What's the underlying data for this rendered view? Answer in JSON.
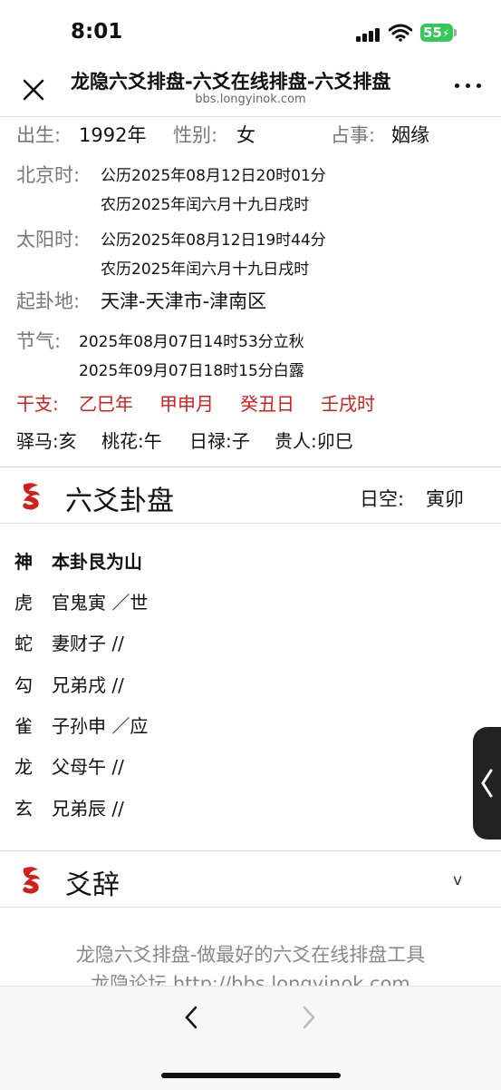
{
  "status": {
    "time": "8:01",
    "battery": "55"
  },
  "nav": {
    "title": "龙隐六爻排盘-六爻在线排盘-六爻排盘",
    "url": "bbs.longyinok.com"
  },
  "info": {
    "birth_label": "出生:",
    "birth_value": "1992年",
    "gender_label": "性别:",
    "gender_value": "女",
    "matter_label": "占事:",
    "matter_value": "姻缘",
    "beijing_label": "北京时:",
    "beijing_line1": "公历2025年08月12日20时01分",
    "beijing_line2": "农历2025年闰六月十九日戌时",
    "solar_label": "太阳时:",
    "solar_line1": "公历2025年08月12日19时44分",
    "solar_line2": "农历2025年闰六月十九日戌时",
    "place_label": "起卦地:",
    "place_value": "天津-天津市-津南区",
    "term_label": "节气:",
    "term_line1": "2025年08月07日14时53分立秋",
    "term_line2": "2025年09月07日18时15分白露",
    "ganzhi_label": "干支:",
    "ganzhi": [
      "乙巳年",
      "甲申月",
      "癸丑日",
      "壬戌时"
    ],
    "extras": [
      "驿马:亥",
      "桃花:午",
      "日禄:子",
      "贵人:卯巳"
    ]
  },
  "hexagram": {
    "title": "六爻卦盘",
    "void_label": "日空:",
    "void_value": "寅卯",
    "header_god": "神",
    "header_name": "本卦艮为山",
    "lines": [
      {
        "god": "虎",
        "text": "官鬼寅 ／世"
      },
      {
        "god": "蛇",
        "text": "妻财子 //"
      },
      {
        "god": "勾",
        "text": "兄弟戌 //"
      },
      {
        "god": "雀",
        "text": "子孙申 ／应"
      },
      {
        "god": "龙",
        "text": "父母午 //"
      },
      {
        "god": "玄",
        "text": "兄弟辰 //"
      }
    ]
  },
  "ci": {
    "title": "爻辞",
    "toggle": "v"
  },
  "footer": {
    "line1": "龙隐六爻排盘-做最好的六爻在线排盘工具",
    "line2": "龙隐论坛 http://bbs.longyinok.com"
  },
  "icons": {
    "close": "close-icon",
    "more": "more-icon",
    "back": "chevron-left-icon",
    "forward": "chevron-right-icon",
    "dragon": "dragon-logo-icon"
  },
  "colors": {
    "ganzhi": "#d0201c",
    "dragon": "#d0201c"
  }
}
